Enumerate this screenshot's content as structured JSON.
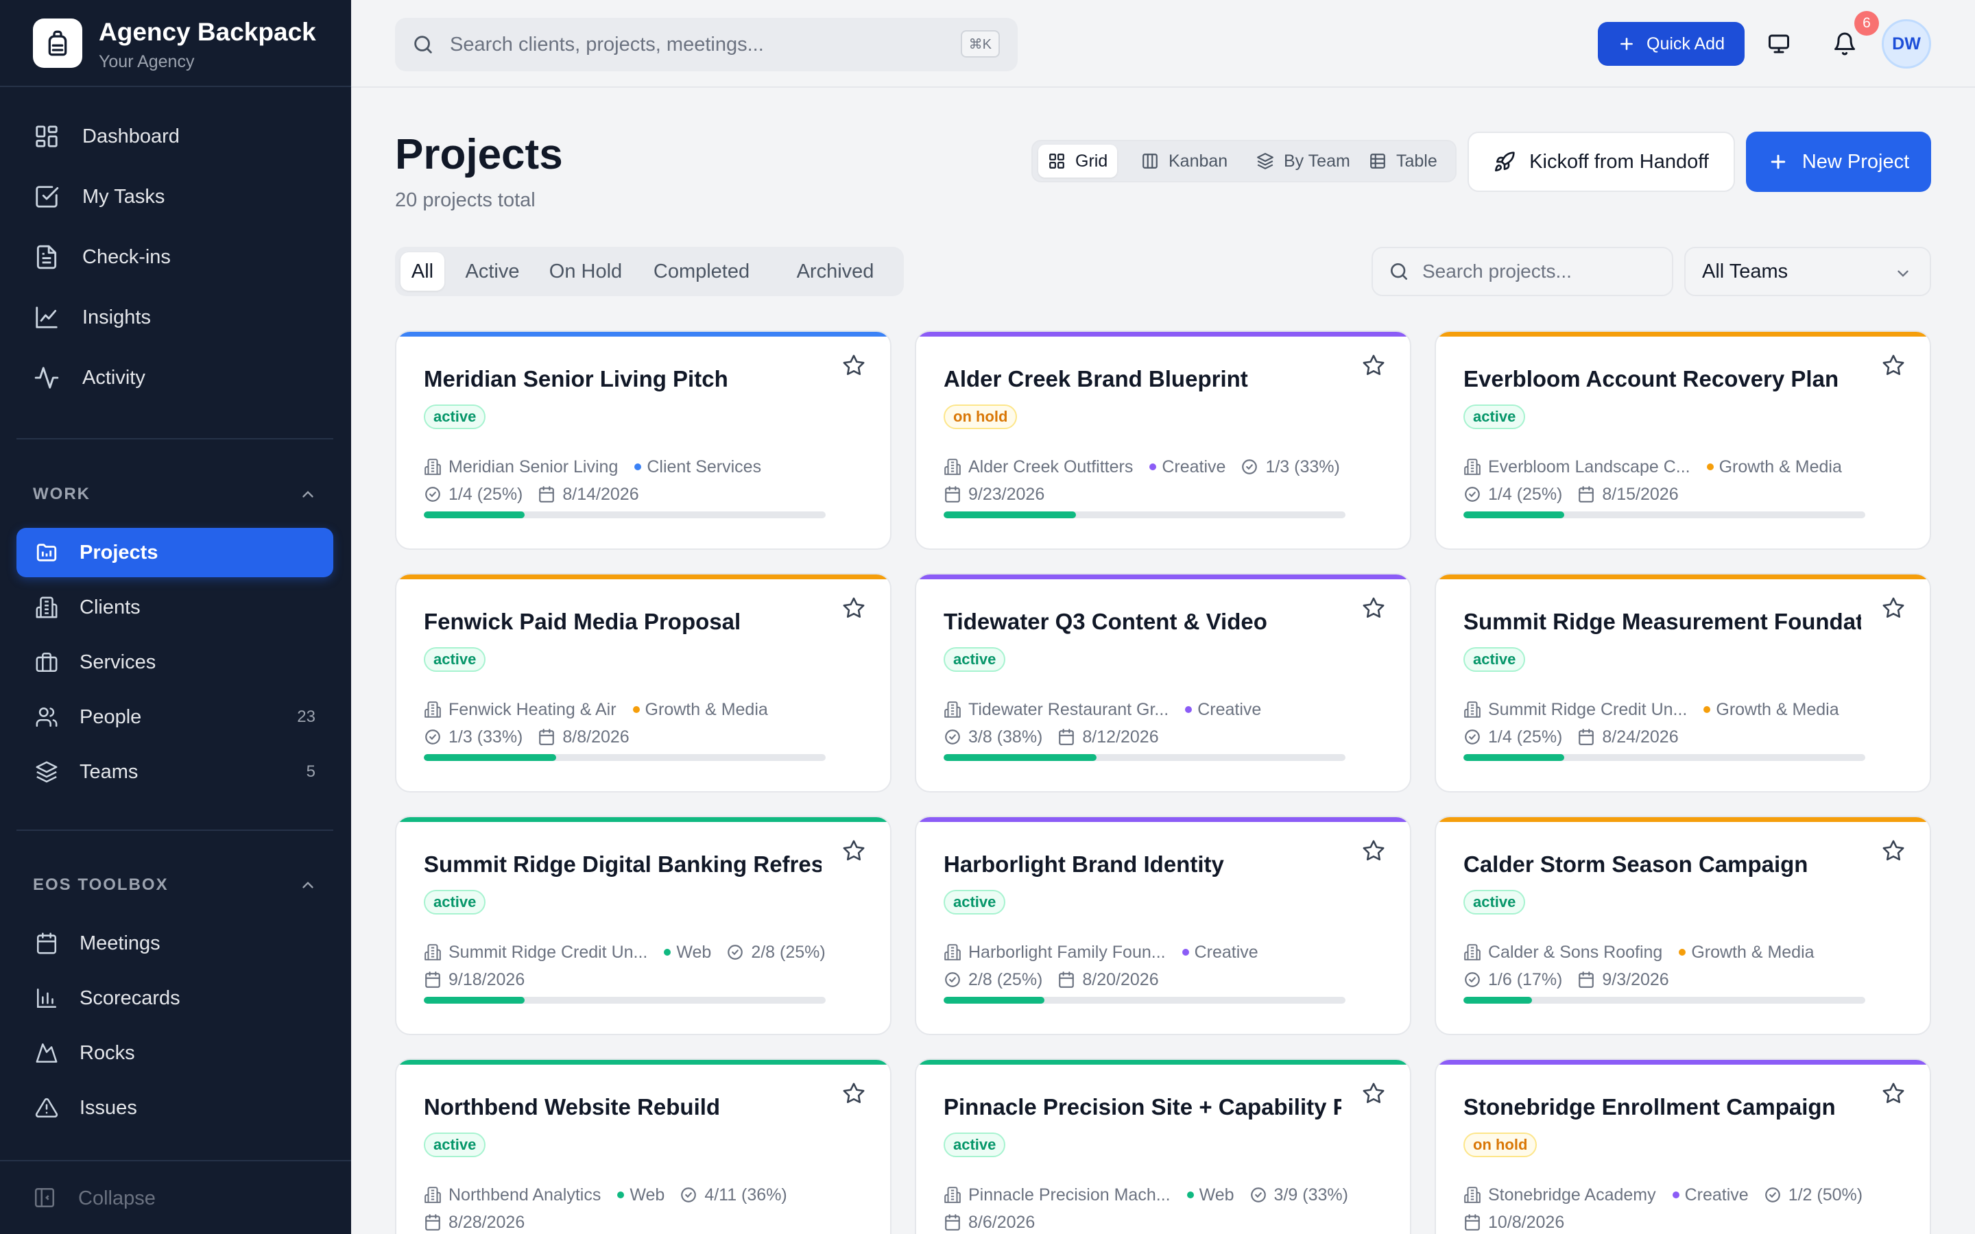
{
  "brand": {
    "name": "Agency Backpack",
    "subtitle": "Your Agency"
  },
  "nav": {
    "primary": [
      {
        "label": "Dashboard",
        "icon": "dashboard-icon"
      },
      {
        "label": "My Tasks",
        "icon": "checkbox-icon"
      },
      {
        "label": "Check-ins",
        "icon": "document-icon"
      },
      {
        "label": "Insights",
        "icon": "line-chart-icon"
      },
      {
        "label": "Activity",
        "icon": "activity-icon"
      }
    ],
    "work_section": "WORK",
    "work": [
      {
        "label": "Projects",
        "icon": "projects-icon",
        "count": ""
      },
      {
        "label": "Clients",
        "icon": "building-icon",
        "count": ""
      },
      {
        "label": "Services",
        "icon": "briefcase-icon",
        "count": ""
      },
      {
        "label": "People",
        "icon": "people-icon",
        "count": "23"
      },
      {
        "label": "Teams",
        "icon": "layers-icon",
        "count": "5"
      }
    ],
    "eos_section": "EOS TOOLBOX",
    "eos": [
      {
        "label": "Meetings",
        "icon": "calendar-icon"
      },
      {
        "label": "Scorecards",
        "icon": "bar-chart-icon"
      },
      {
        "label": "Rocks",
        "icon": "mountain-icon"
      },
      {
        "label": "Issues",
        "icon": "warning-icon"
      }
    ],
    "collapse_label": "Collapse"
  },
  "topbar": {
    "search_placeholder": "Search clients, projects, meetings...",
    "shortcut": "⌘K",
    "quick_add_label": "Quick Add",
    "notification_count": "6",
    "avatar_initials": "DW"
  },
  "page": {
    "title": "Projects",
    "subtitle": "20 projects total",
    "views": [
      "Grid",
      "Kanban",
      "By Team",
      "Table"
    ],
    "selected_view": "Grid",
    "kickoff_label": "Kickoff from Handoff",
    "new_project_label": "New Project",
    "status_tabs": [
      "All",
      "Active",
      "On Hold",
      "Completed",
      "Archived"
    ],
    "selected_status": "All",
    "project_search_placeholder": "Search projects...",
    "team_filter": "All Teams"
  },
  "colors": {
    "accent": "#2563eb",
    "sidebar_bg": "#131c2e",
    "progress": "#10b981",
    "team_client_services": "#3b82f6",
    "team_creative": "#8b5cf6",
    "team_growth_media": "#f59e0b",
    "team_web": "#10b981"
  },
  "projects": [
    {
      "title": "Meridian Senior Living Pitch",
      "status": "active",
      "client": "Meridian Senior Living",
      "team": "Client Services",
      "team_color": "#3b82f6",
      "tasks": "1/4 (25%)",
      "due": "8/14/2026",
      "progress": 0.25
    },
    {
      "title": "Alder Creek Brand Blueprint",
      "status": "on hold",
      "client": "Alder Creek Outfitters",
      "team": "Creative",
      "team_color": "#8b5cf6",
      "tasks": "1/3 (33%)",
      "due": "9/23/2026",
      "progress": 0.33
    },
    {
      "title": "Everbloom Account Recovery Plan",
      "status": "active",
      "client": "Everbloom Landscape C...",
      "team": "Growth & Media",
      "team_color": "#f59e0b",
      "tasks": "1/4 (25%)",
      "due": "8/15/2026",
      "progress": 0.25
    },
    {
      "title": "Fenwick Paid Media Proposal",
      "status": "active",
      "client": "Fenwick Heating & Air",
      "team": "Growth & Media",
      "team_color": "#f59e0b",
      "tasks": "1/3 (33%)",
      "due": "8/8/2026",
      "progress": 0.33
    },
    {
      "title": "Tidewater Q3 Content & Video",
      "status": "active",
      "client": "Tidewater Restaurant Gr...",
      "team": "Creative",
      "team_color": "#8b5cf6",
      "tasks": "3/8 (38%)",
      "due": "8/12/2026",
      "progress": 0.38
    },
    {
      "title": "Summit Ridge Measurement Foundation",
      "status": "active",
      "client": "Summit Ridge Credit Un...",
      "team": "Growth & Media",
      "team_color": "#f59e0b",
      "tasks": "1/4 (25%)",
      "due": "8/24/2026",
      "progress": 0.25
    },
    {
      "title": "Summit Ridge Digital Banking Refresh",
      "status": "active",
      "client": "Summit Ridge Credit Un...",
      "team": "Web",
      "team_color": "#10b981",
      "tasks": "2/8 (25%)",
      "due": "9/18/2026",
      "progress": 0.25
    },
    {
      "title": "Harborlight Brand Identity",
      "status": "active",
      "client": "Harborlight Family Foun...",
      "team": "Creative",
      "team_color": "#8b5cf6",
      "tasks": "2/8 (25%)",
      "due": "8/20/2026",
      "progress": 0.25
    },
    {
      "title": "Calder Storm Season Campaign",
      "status": "active",
      "client": "Calder & Sons Roofing",
      "team": "Growth & Media",
      "team_color": "#f59e0b",
      "tasks": "1/6 (17%)",
      "due": "9/3/2026",
      "progress": 0.17
    },
    {
      "title": "Northbend Website Rebuild",
      "status": "active",
      "client": "Northbend Analytics",
      "team": "Web",
      "team_color": "#10b981",
      "tasks": "4/11 (36%)",
      "due": "8/28/2026",
      "progress": 0.36
    },
    {
      "title": "Pinnacle Precision Site + Capability Pa...",
      "status": "active",
      "client": "Pinnacle Precision Mach...",
      "team": "Web",
      "team_color": "#10b981",
      "tasks": "3/9 (33%)",
      "due": "8/6/2026",
      "progress": 0.33
    },
    {
      "title": "Stonebridge Enrollment Campaign",
      "status": "on hold",
      "client": "Stonebridge Academy",
      "team": "Creative",
      "team_color": "#8b5cf6",
      "tasks": "1/2 (50%)",
      "due": "10/8/2026",
      "progress": 0.5
    }
  ]
}
